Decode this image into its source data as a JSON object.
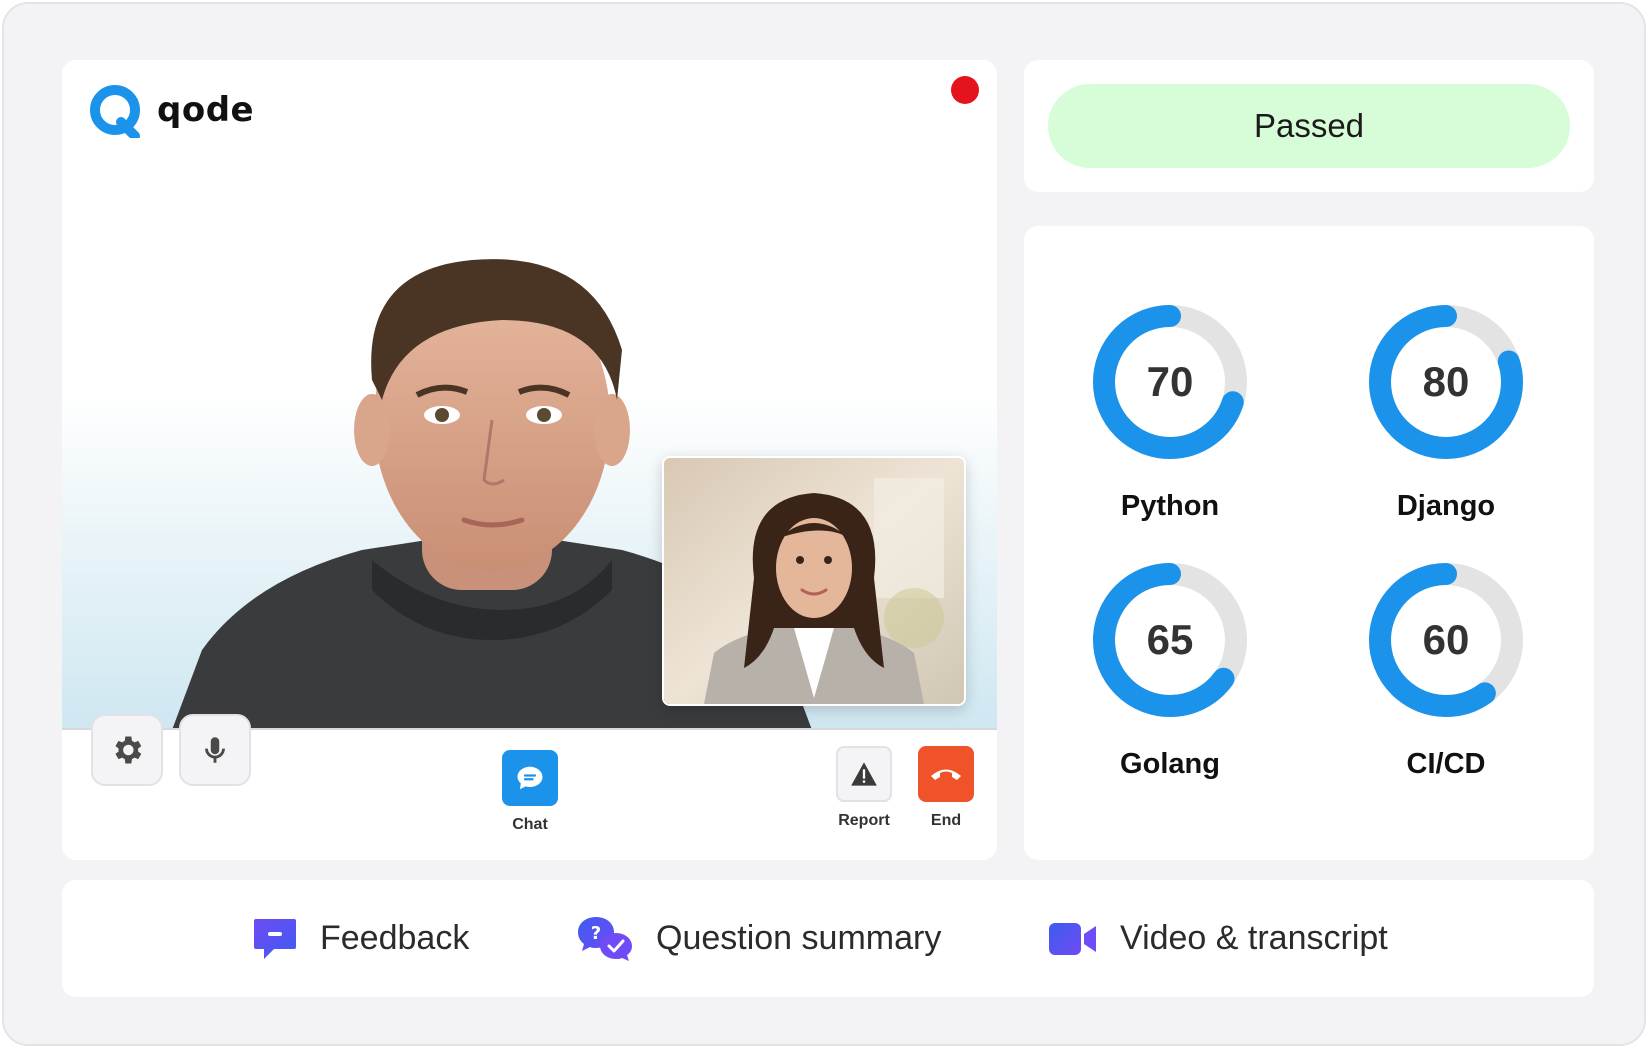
{
  "brand": {
    "name": "qode",
    "logo_icon": "qode-logo-icon",
    "accent": "#1b93ea"
  },
  "recording": {
    "icon": "recording-dot-icon",
    "color": "#e5131c"
  },
  "controls": {
    "settings_icon": "gear-icon",
    "mic_icon": "microphone-icon",
    "chat_label": "Chat",
    "report_label": "Report",
    "end_label": "End"
  },
  "status": {
    "label": "Passed",
    "color": "#d6fdd8"
  },
  "skills": [
    {
      "name": "Python",
      "score": 70
    },
    {
      "name": "Django",
      "score": 80
    },
    {
      "name": "Golang",
      "score": 65
    },
    {
      "name": "CI/CD",
      "score": 60
    }
  ],
  "gauge_colors": {
    "fill": "#1b93ea",
    "track": "#e3e3e3"
  },
  "nav": [
    {
      "label": "Feedback",
      "icon": "feedback-icon"
    },
    {
      "label": "Question summary",
      "icon": "question-summary-icon"
    },
    {
      "label": "Video & transcript",
      "icon": "video-camera-icon"
    }
  ]
}
